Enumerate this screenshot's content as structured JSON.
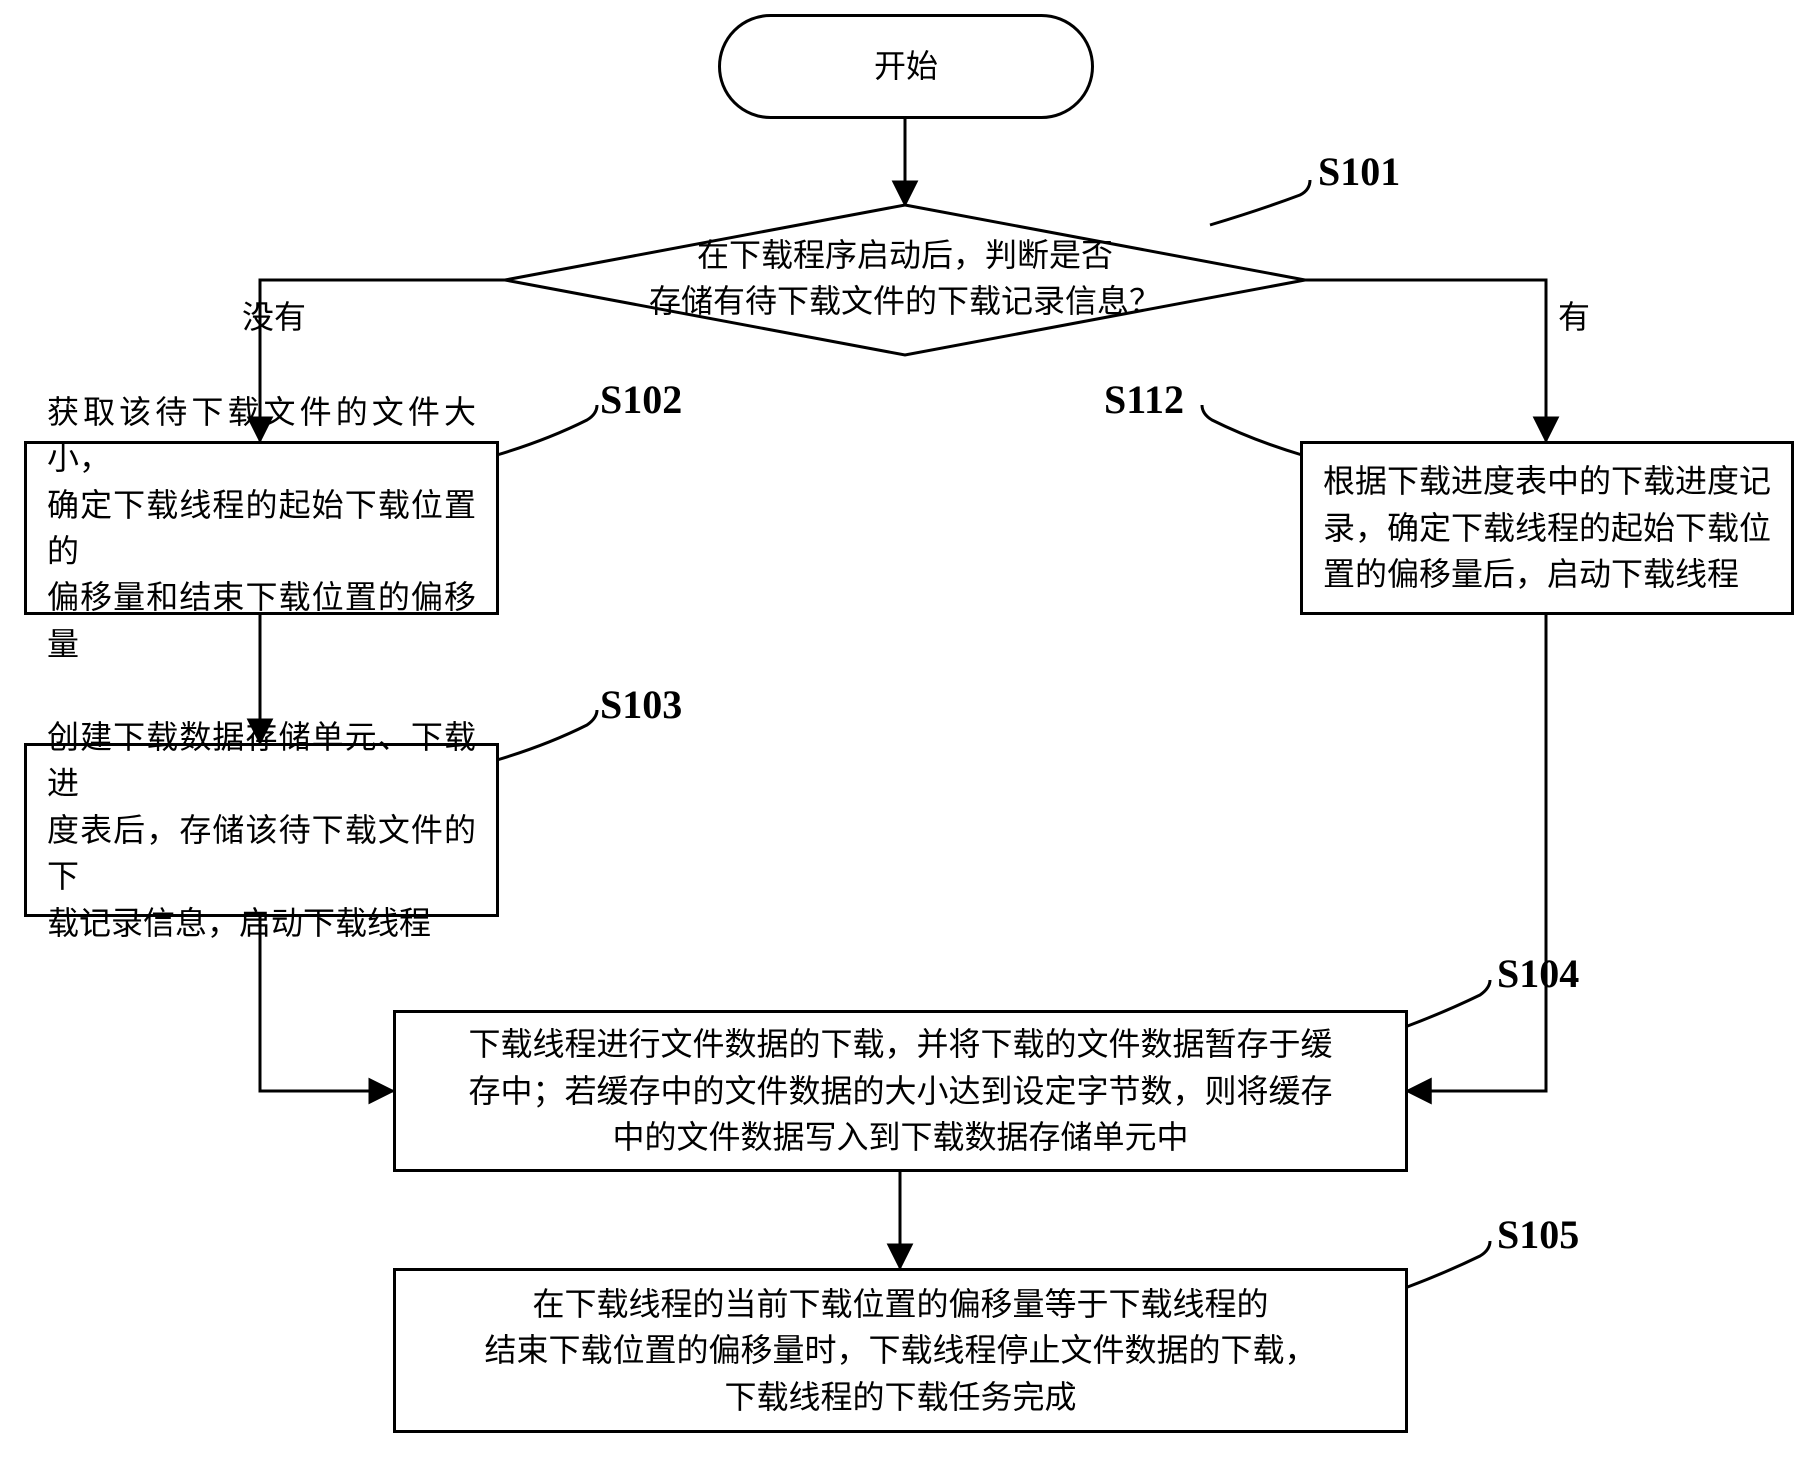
{
  "start": {
    "text": "开始"
  },
  "decision": {
    "line1": "在下载程序启动后，判断是否",
    "line2": "存储有待下载文件的下载记录信息？",
    "edge_no": "没有",
    "edge_yes": "有"
  },
  "s101": {
    "label": "S101"
  },
  "s102": {
    "label": "S102",
    "line1": "获取该待下载文件的文件大小，",
    "line2": "确定下载线程的起始下载位置的",
    "line3": "偏移量和结束下载位置的偏移量"
  },
  "s112": {
    "label": "S112",
    "line1": "根据下载进度表中的下载进度记",
    "line2": "录，确定下载线程的起始下载位",
    "line3": "置的偏移量后，启动下载线程"
  },
  "s103": {
    "label": "S103",
    "line1": "创建下载数据存储单元、下载进",
    "line2": "度表后，存储该待下载文件的下",
    "line3": "载记录信息，启动下载线程"
  },
  "s104": {
    "label": "S104",
    "line1": "下载线程进行文件数据的下载，并将下载的文件数据暂存于缓",
    "line2": "存中；若缓存中的文件数据的大小达到设定字节数，则将缓存",
    "line3": "中的文件数据写入到下载数据存储单元中"
  },
  "s105": {
    "label": "S105",
    "line1": "在下载线程的当前下载位置的偏移量等于下载线程的",
    "line2": "结束下载位置的偏移量时，下载线程停止文件数据的下载，",
    "line3": "下载线程的下载任务完成"
  }
}
